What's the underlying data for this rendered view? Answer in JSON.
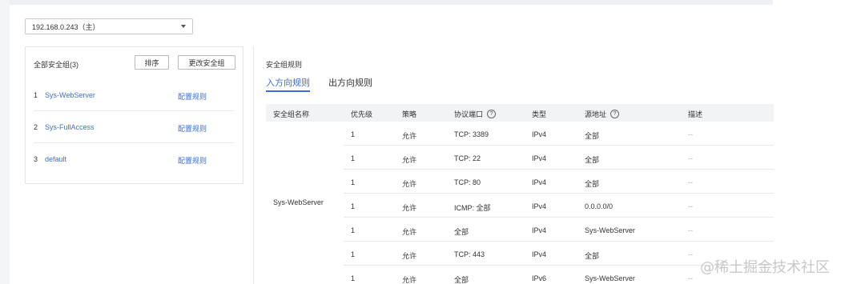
{
  "selector": {
    "value": "192.168.0.243（主）"
  },
  "left_panel": {
    "title": "全部安全组(3)",
    "sort_label": "排序",
    "change_label": "更改安全组",
    "groups": [
      {
        "index": "1",
        "name": "Sys-WebServer",
        "action": "配置规则"
      },
      {
        "index": "2",
        "name": "Sys-FullAccess",
        "action": "配置规则"
      },
      {
        "index": "3",
        "name": "default",
        "action": "配置规则"
      }
    ]
  },
  "rules": {
    "title": "安全组规则",
    "tabs": [
      {
        "label": "入方向规则"
      },
      {
        "label": "出方向规则"
      }
    ],
    "columns": {
      "group": "安全组名称",
      "priority": "优先级",
      "policy": "策略",
      "port": "协议端口",
      "type": "类型",
      "source": "源地址",
      "desc": "描述"
    },
    "merged_group": "Sys-WebServer",
    "rows": [
      {
        "priority": "1",
        "policy": "允许",
        "port": "TCP: 3389",
        "type": "IPv4",
        "source": "全部",
        "desc": "--"
      },
      {
        "priority": "1",
        "policy": "允许",
        "port": "TCP: 22",
        "type": "IPv4",
        "source": "全部",
        "desc": "--"
      },
      {
        "priority": "1",
        "policy": "允许",
        "port": "TCP: 80",
        "type": "IPv4",
        "source": "全部",
        "desc": "--"
      },
      {
        "priority": "1",
        "policy": "允许",
        "port": "ICMP: 全部",
        "type": "IPv4",
        "source": "0.0.0.0/0",
        "desc": "--"
      },
      {
        "priority": "1",
        "policy": "允许",
        "port": "全部",
        "type": "IPv4",
        "source": "Sys-WebServer",
        "desc": "--"
      },
      {
        "priority": "1",
        "policy": "允许",
        "port": "TCP: 443",
        "type": "IPv4",
        "source": "全部",
        "desc": "--"
      },
      {
        "priority": "1",
        "policy": "允许",
        "port": "全部",
        "type": "IPv6",
        "source": "Sys-WebServer",
        "desc": "--"
      }
    ]
  },
  "watermark": "@稀土掘金技术社区",
  "colors": {
    "link": "#3a6fd8",
    "header_bg": "#f2f3f5",
    "border": "#e8e9eb"
  }
}
